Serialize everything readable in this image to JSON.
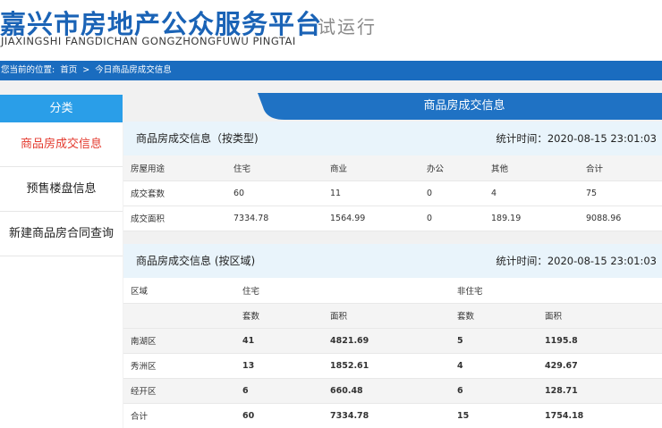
{
  "header": {
    "logo_cn": "嘉兴市房地产公众服务平台",
    "logo_en": "JIAXINGSHI FANGDICHAN GONGZHONGFUWU PINGTAI",
    "trial": "试运行"
  },
  "breadcrumb": {
    "prefix": "您当前的位置:",
    "home": "首页",
    "separator": ">",
    "current": "今日商品房成交信息"
  },
  "sidebar": {
    "title": "分类",
    "items": [
      {
        "label": "商品房成交信息",
        "active": true
      },
      {
        "label": "预售楼盘信息",
        "active": false
      },
      {
        "label": "新建商品房合同查询",
        "active": false
      }
    ]
  },
  "main": {
    "tab_label": "商品房成交信息",
    "by_type": {
      "title": "商品房成交信息（按类型)",
      "time": "统计时间：2020-08-15 23:01:03",
      "header": [
        "房屋用途",
        "住宅",
        "商业",
        "办公",
        "其他",
        "合计"
      ],
      "rows": [
        [
          "成交套数",
          "60",
          "11",
          "0",
          "4",
          "75"
        ],
        [
          "成交面积",
          "7334.78",
          "1564.99",
          "0",
          "189.19",
          "9088.96"
        ]
      ]
    },
    "by_region": {
      "title": "商品房成交信息 (按区域)",
      "time": "统计时间：2020-08-15 23:01:03",
      "header1": [
        "区域",
        "住宅",
        "非住宅"
      ],
      "header2": [
        "套数",
        "面积",
        "套数",
        "面积"
      ],
      "rows": [
        [
          "南湖区",
          "41",
          "4821.69",
          "5",
          "1195.8"
        ],
        [
          "秀洲区",
          "13",
          "1852.61",
          "4",
          "429.67"
        ],
        [
          "经开区",
          "6",
          "660.48",
          "6",
          "128.71"
        ],
        [
          "合计",
          "60",
          "7334.78",
          "15",
          "1754.18"
        ]
      ]
    }
  },
  "colors": {
    "brand_blue": "#1a63b6",
    "bar_blue": "#1a6cbf",
    "sidebar_head": "#2a9ee8",
    "active_red": "#e43b2f"
  }
}
